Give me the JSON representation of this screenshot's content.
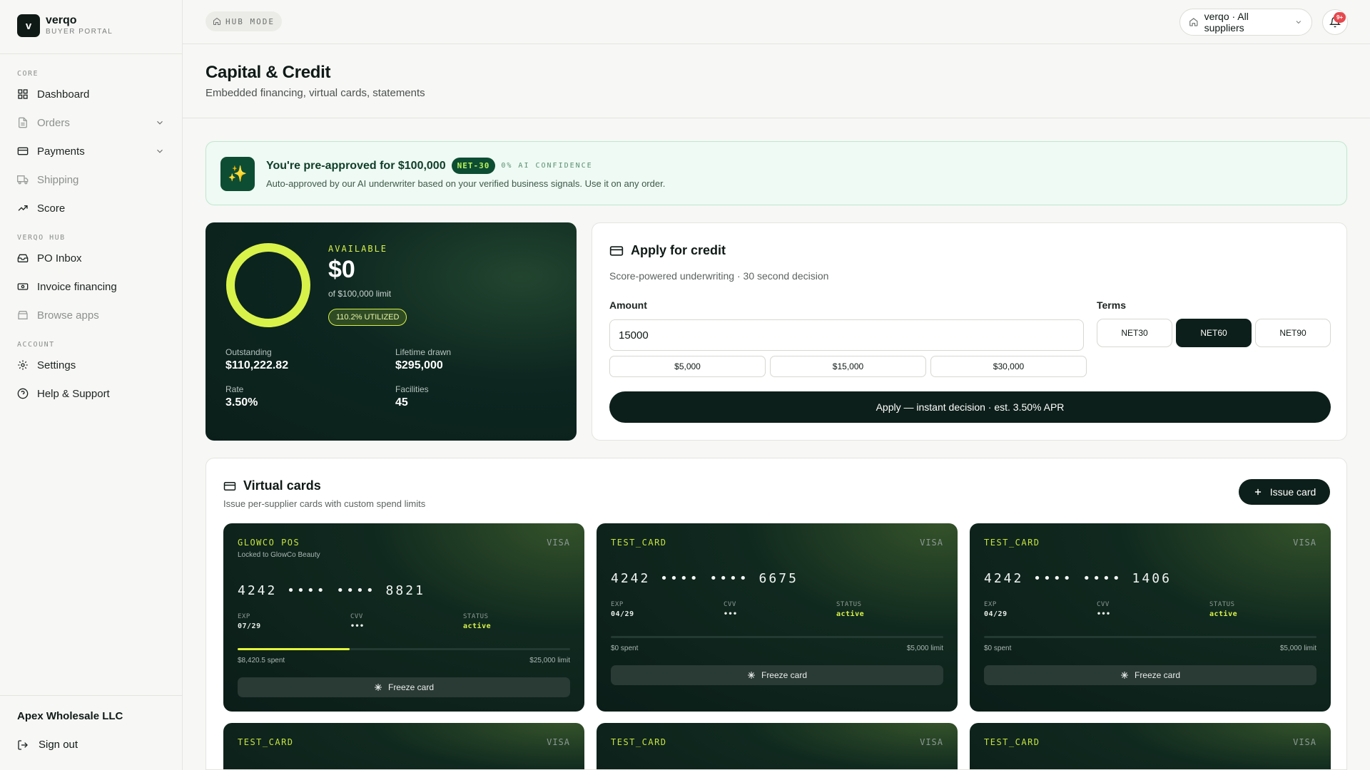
{
  "app": {
    "logo_letter": "v",
    "name": "verqo",
    "subtitle": "BUYER PORTAL"
  },
  "sidebar": {
    "sections": [
      {
        "label": "CORE",
        "items": [
          {
            "label": "Dashboard",
            "icon": "grid-icon"
          },
          {
            "label": "Orders",
            "icon": "document-icon",
            "expandable": true,
            "dimmed": true
          },
          {
            "label": "Payments",
            "icon": "credit-card-icon",
            "expandable": true
          },
          {
            "label": "Shipping",
            "icon": "truck-icon",
            "dimmed": true
          },
          {
            "label": "Score",
            "icon": "trending-up-icon"
          }
        ]
      },
      {
        "label": "VERQO HUB",
        "items": [
          {
            "label": "PO Inbox",
            "icon": "inbox-icon"
          },
          {
            "label": "Invoice financing",
            "icon": "banknote-icon"
          },
          {
            "label": "Browse apps",
            "icon": "store-icon",
            "dimmed": true
          }
        ]
      },
      {
        "label": "ACCOUNT",
        "items": [
          {
            "label": "Settings",
            "icon": "gear-icon"
          },
          {
            "label": "Help & Support",
            "icon": "help-circle-icon"
          }
        ]
      }
    ],
    "company": "Apex Wholesale LLC",
    "signout": "Sign out"
  },
  "topbar": {
    "mode": "HUB MODE",
    "supplier": "verqo · All suppliers",
    "notif_count": "9+"
  },
  "page": {
    "title": "Capital & Credit",
    "subtitle": "Embedded financing, virtual cards, statements"
  },
  "banner": {
    "title": "You're pre-approved for $100,000",
    "tag": "NET-30",
    "confidence": "0% AI CONFIDENCE",
    "subtitle": "Auto-approved by our AI underwriter based on your verified business signals. Use it on any order."
  },
  "credit": {
    "available_label": "AVAILABLE",
    "available_value": "$0",
    "limit_text": "of $100,000 limit",
    "utilized": "110.2% UTILIZED",
    "utilization_fraction": 1.0,
    "stats": {
      "outstanding_label": "Outstanding",
      "outstanding": "$110,222.82",
      "lifetime_label": "Lifetime drawn",
      "lifetime": "$295,000",
      "rate_label": "Rate",
      "rate": "3.50%",
      "facilities_label": "Facilities",
      "facilities": "45"
    },
    "colors": {
      "ring": "#d9f24a",
      "panel": "#0b1f1a"
    }
  },
  "apply": {
    "title": "Apply for credit",
    "subtitle": "Score-powered underwriting · 30 second decision",
    "amount_label": "Amount",
    "amount_value": "15000",
    "presets": [
      "$5,000",
      "$15,000",
      "$30,000"
    ],
    "terms_label": "Terms",
    "terms": [
      "NET30",
      "NET60",
      "NET90"
    ],
    "selected_term": "NET60",
    "button": "Apply — instant decision · est. 3.50% APR"
  },
  "virtual_cards": {
    "title": "Virtual cards",
    "subtitle": "Issue per-supplier cards with custom spend limits",
    "issue_button": "Issue card",
    "labels": {
      "exp": "EXP",
      "cvv": "CVV",
      "status": "STATUS",
      "freeze": "Freeze card"
    },
    "cards": [
      {
        "name": "GLOWCO POS",
        "lock": "Locked to GlowCo Beauty",
        "network": "VISA",
        "number": "4242 •••• •••• 8821",
        "exp": "07/29",
        "cvv": "•••",
        "status": "active",
        "spent": "$8,420.5 spent",
        "limit": "$25,000 limit",
        "spent_fraction": 0.337
      },
      {
        "name": "TEST_CARD",
        "network": "VISA",
        "number": "4242 •••• •••• 6675",
        "exp": "04/29",
        "cvv": "•••",
        "status": "active",
        "spent": "$0 spent",
        "limit": "$5,000 limit",
        "spent_fraction": 0
      },
      {
        "name": "TEST_CARD",
        "network": "VISA",
        "number": "4242 •••• •••• 1406",
        "exp": "04/29",
        "cvv": "•••",
        "status": "active",
        "spent": "$0 spent",
        "limit": "$5,000 limit",
        "spent_fraction": 0
      },
      {
        "name": "TEST_CARD",
        "network": "VISA"
      },
      {
        "name": "TEST_CARD",
        "network": "VISA"
      },
      {
        "name": "TEST_CARD",
        "network": "VISA"
      }
    ]
  }
}
